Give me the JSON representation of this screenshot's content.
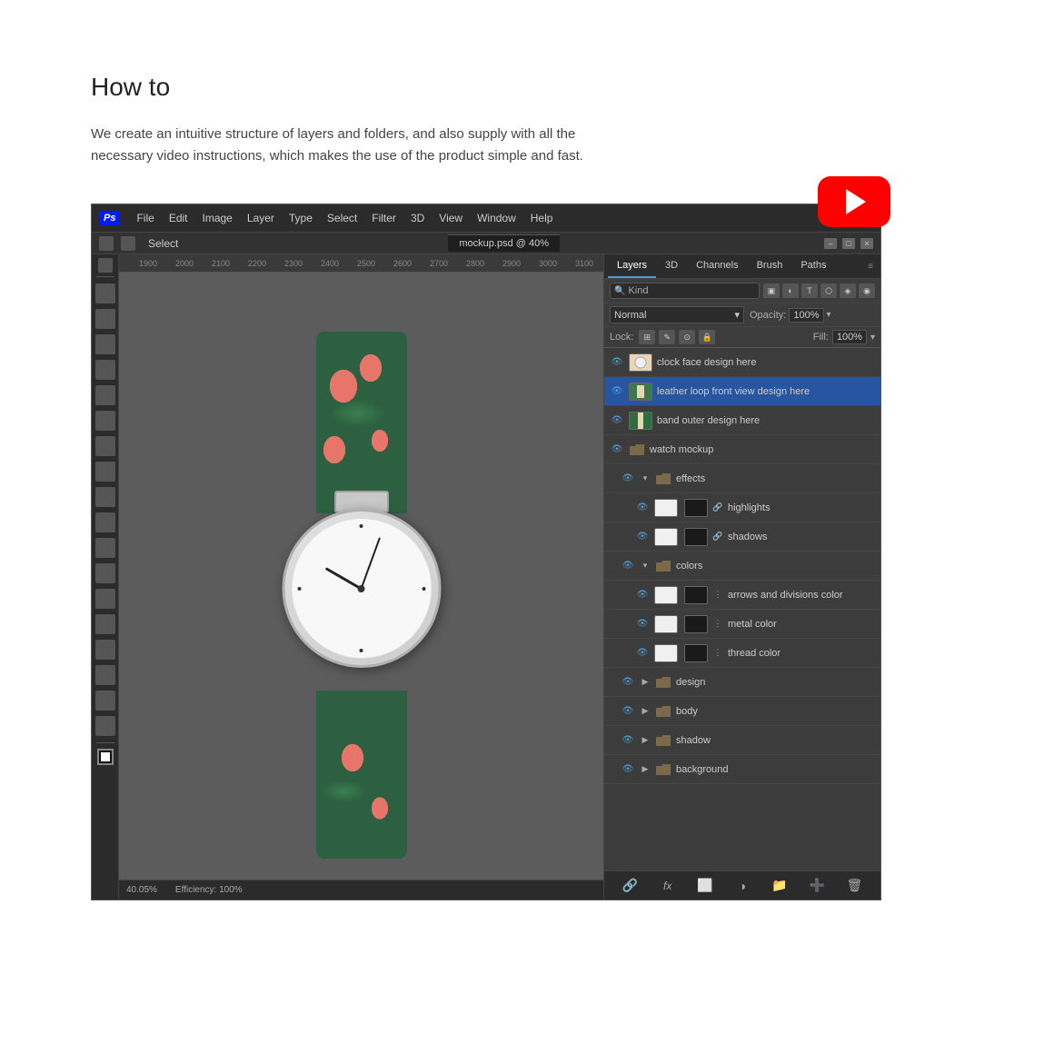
{
  "page": {
    "title": "How to",
    "description": "We create an intuitive structure of layers and folders, and also supply with all the necessary video instructions, which makes the use of the product simple and fast."
  },
  "ps_window": {
    "menu_items": [
      "File",
      "Edit",
      "Image",
      "Layer",
      "Type",
      "Select",
      "Filter",
      "3D",
      "View",
      "Window",
      "Help"
    ],
    "toolbar_select": "Select",
    "blend_mode": "Normal",
    "opacity_label": "Opacity:",
    "opacity_value": "100%",
    "lock_label": "Lock:",
    "fill_label": "Fill:",
    "fill_value": "100%",
    "layers_tab": "Layers",
    "tabs": [
      "3D",
      "Channels",
      "Brush",
      "Paths"
    ],
    "filter_label": "Kind",
    "status_zoom": "40.05%",
    "status_efficiency": "Efficiency: 100%"
  },
  "layers": [
    {
      "id": 1,
      "name": "clock face design here",
      "type": "layer",
      "indent": 0,
      "visible": true,
      "thumb": "watch"
    },
    {
      "id": 2,
      "name": "leather loop front view design here",
      "type": "layer",
      "indent": 0,
      "visible": true,
      "thumb": "watch"
    },
    {
      "id": 3,
      "name": "band outer design here",
      "type": "layer",
      "indent": 0,
      "visible": true,
      "thumb": "watch"
    },
    {
      "id": 4,
      "name": "watch mockup",
      "type": "folder",
      "indent": 0,
      "visible": true
    },
    {
      "id": 5,
      "name": "effects",
      "type": "folder",
      "indent": 1,
      "visible": true
    },
    {
      "id": 6,
      "name": "highlights",
      "type": "layer",
      "indent": 2,
      "visible": true,
      "thumb": "black"
    },
    {
      "id": 7,
      "name": "shadows",
      "type": "layer",
      "indent": 2,
      "visible": true,
      "thumb": "black"
    },
    {
      "id": 8,
      "name": "colors",
      "type": "folder",
      "indent": 1,
      "visible": true
    },
    {
      "id": 9,
      "name": "arrows and divisions color",
      "type": "layer",
      "indent": 2,
      "visible": true,
      "thumb": "black"
    },
    {
      "id": 10,
      "name": "metal color",
      "type": "layer",
      "indent": 2,
      "visible": true,
      "thumb": "black"
    },
    {
      "id": 11,
      "name": "thread color",
      "type": "layer",
      "indent": 2,
      "visible": true,
      "thumb": "black"
    },
    {
      "id": 12,
      "name": "design",
      "type": "folder",
      "indent": 1,
      "visible": true
    },
    {
      "id": 13,
      "name": "body",
      "type": "folder",
      "indent": 1,
      "visible": true
    },
    {
      "id": 14,
      "name": "shadow",
      "type": "folder",
      "indent": 1,
      "visible": true
    },
    {
      "id": 15,
      "name": "background",
      "type": "folder",
      "indent": 1,
      "visible": true
    }
  ],
  "ruler_numbers": [
    "1900",
    "2000",
    "2100",
    "2200",
    "2300",
    "2400",
    "2500",
    "2600",
    "2700",
    "2800",
    "2900",
    "3000",
    "3100"
  ]
}
